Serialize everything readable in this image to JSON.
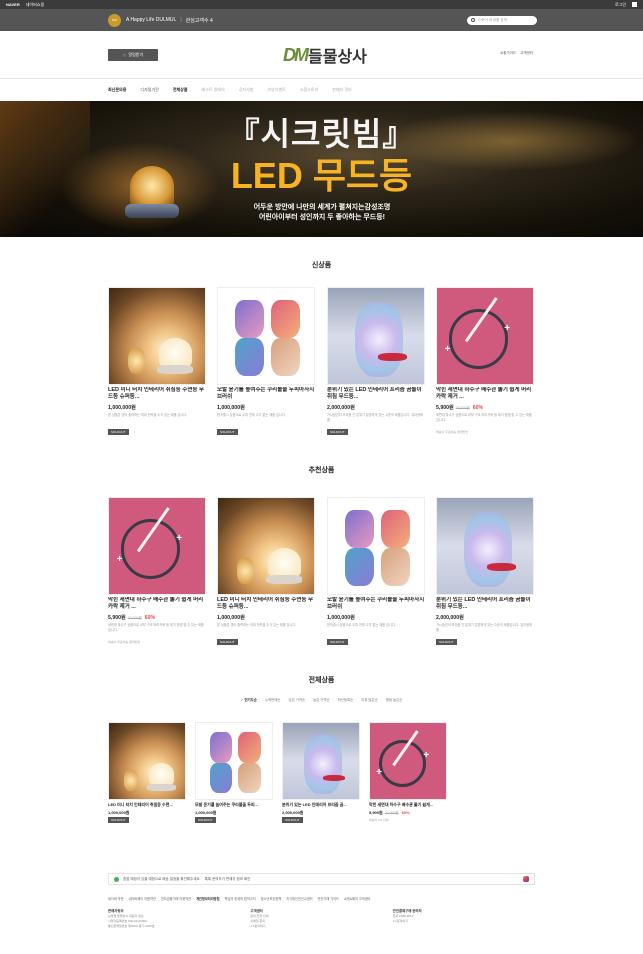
{
  "topbar": {
    "naver": "NAVER",
    "service": "네이버쇼핑",
    "login": "로그인"
  },
  "store": {
    "name": "A Happy Life DULMUL",
    "favorite": "관심고객수 4",
    "search_placeholder": "스토어 내 상품 검색"
  },
  "header": {
    "fav_button": "알림받기",
    "logo_mark": "DM",
    "logo_text": "들물상사",
    "links": [
      "쇼핑가이드",
      "고객센터"
    ]
  },
  "nav": [
    {
      "label": "최신문의용",
      "state": "active"
    },
    {
      "label": "디자털기전",
      "state": "normal"
    },
    {
      "label": "전체상품",
      "state": "active"
    },
    {
      "label": "베스트 알레이",
      "state": "muted"
    },
    {
      "label": "공지사항",
      "state": "muted"
    },
    {
      "label": "리뷰이벤트",
      "state": "muted"
    },
    {
      "label": "쇼핑스토리",
      "state": "muted"
    },
    {
      "label": "판매자 정보",
      "state": "muted"
    }
  ],
  "banner": {
    "title_line1": "『시크릿빔』",
    "title_line2": "LED 무드등",
    "sub_line1": "어두운 방안에 나만의 세계가 펼쳐지는감성조명",
    "sub_line2": "어린아이부터 성인까지 두 좋아하는 무드등!"
  },
  "sections": {
    "new_title": "신상품",
    "recommend_title": "추천상품",
    "all_title": "전체상품"
  },
  "products": {
    "lamp": {
      "name": "LED 미니 터치 인테리어 취침등 수면등 무드등 슈퍼등...",
      "price": "1,000,000원",
      "desc": "본 상품은 영어 출력하는 최대 전력을 수가 있는 제품 입니다.",
      "badge": "SOLDOUT"
    },
    "comb": {
      "name": "모발 윤기를 높여주는 쿠리볼을 두피마사지 브러쉬",
      "price": "1,000,000원",
      "desc": "한국출시 상품으로 두피 전체 수가 없는 제품 입니다.",
      "badge": "SOLDOUT"
    },
    "bear": {
      "name": "분위기 있는 LED 인테리어 프리즘 곰돌이 취침 무드등...",
      "price": "2,000,000원",
      "desc": "가시광선의 프리즘 간 분위기 분명하게 있는 수준의 제품입니다. 유아용제품.",
      "badge": "SOLDOUT"
    },
    "hose": {
      "name": "막힌 세면대 하수구 배수관 뚫기 쉽게 머리카락 제거 ...",
      "price": "5,900원",
      "orig": "20,000원",
      "rate": "60%",
      "desc": "세면대 하수구 상품으로 내부 구조 머리카락 등 제거 방법 할 수 있는 제품입니다.",
      "tags": "배송비  무료배송  결제방법"
    },
    "all_lamp": {
      "name": "LED 미니 터치 인테리어 취침등 수면...",
      "price": "1,000,000원",
      "badge": "SOLDOUT"
    },
    "all_comb": {
      "name": "모발 윤기를 높여주는 쿠리볼을 두피...",
      "price": "1,000,000원",
      "badge": "SOLDOUT"
    },
    "all_bear": {
      "name": "분위기 있는 LED 인테리어 프리즘 곰...",
      "price": "2,000,000원",
      "badge": "SOLDOUT"
    },
    "all_hose": {
      "name": "막힌 세면대 하수구 배수관 뚫기 쉽게...",
      "price": "5,900원",
      "orig": "20,000원",
      "rate": "60%",
      "tags": "배송비 4.5 리뷰"
    }
  },
  "sort_tabs": [
    {
      "label": "✓ 인기도순",
      "on": true
    },
    {
      "label": "누적판매순",
      "on": false
    },
    {
      "label": "낮은 가격순",
      "on": false
    },
    {
      "label": "높은 가격순",
      "on": false
    },
    {
      "label": "최신등록순",
      "on": false
    },
    {
      "label": "리뷰 많은순",
      "on": false
    },
    {
      "label": "평점 높은순",
      "on": false
    }
  ],
  "footer": {
    "notice": "혼잡 예정이 있을 예정으로 배송 일정을 확인해주세요.",
    "notice_mid": "톡톡  문의하기  판매자 정보 확인",
    "links": [
      "네이버 약관",
      "네이버페이 이용약관",
      "전자금융거래 이용약관",
      "개인정보처리방침",
      "책임의 한계와 법적고지",
      "청소년보호정책",
      "지식재산권신고센터",
      "안전거래 가이드",
      "쇼핑&페이 고객센터"
    ],
    "bold_link": "개인정보처리방침",
    "col1_head": "판매자정보",
    "col1_lines": [
      "상호명 들물상사  대표자 정보",
      "사업자등록번호 000-00-00000",
      "통신판매업번호 제0000-경기-0000호"
    ],
    "col2_head": "고객센터",
    "col2_lines": [
      "문의 전화 안내",
      "이메일 문의",
      "1:1문의하기"
    ],
    "col3_head": "안전결제구매 문의처",
    "col3_lines": [
      "전화 1588-3819",
      "1:1문의하기"
    ]
  }
}
